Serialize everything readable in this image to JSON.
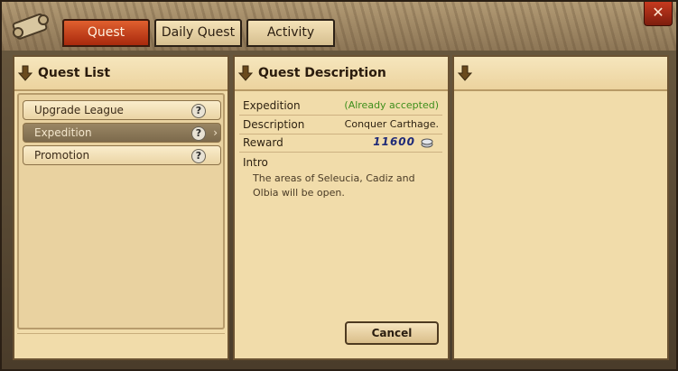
{
  "tabs": {
    "quest": "Quest",
    "daily_quest": "Daily Quest",
    "activity": "Activity"
  },
  "quest_list": {
    "title": "Quest List",
    "items": [
      {
        "label": "Upgrade League",
        "icon": "question-icon"
      },
      {
        "label": "Expedition",
        "icon": "question-icon",
        "selected": true
      },
      {
        "label": "Promotion",
        "icon": "question-icon"
      }
    ]
  },
  "quest_description": {
    "title": "Quest Description",
    "name_label": "Expedition",
    "status": "(Already accepted)",
    "description_label": "Description",
    "description_value": "Conquer Carthage.",
    "reward_label": "Reward",
    "reward_value": "11600",
    "reward_icon": "silver-coin-icon",
    "intro_label": "Intro",
    "intro_text": "The areas of Seleucia, Cadiz and Olbia will be open.",
    "cancel_label": "Cancel"
  },
  "third_panel": {
    "title": ""
  },
  "colors": {
    "active_tab": "#c8451c",
    "accepted_status": "#3f8f1c",
    "reward": "#1f2a78"
  }
}
